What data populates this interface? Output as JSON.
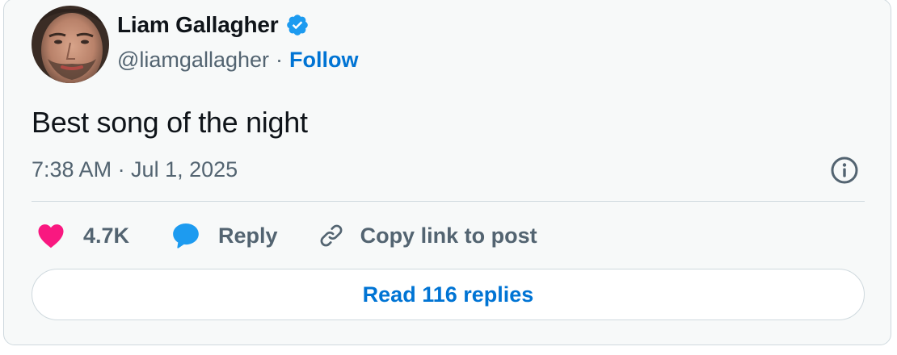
{
  "author": {
    "name": "Liam Gallagher",
    "handle": "@liamgallagher",
    "separator": "·",
    "follow_label": "Follow",
    "verified": true,
    "avatar_icon": "avatar-photo"
  },
  "post": {
    "text": "Best song of the night",
    "timestamp": "7:38 AM · Jul 1, 2025"
  },
  "actions": {
    "like_count": "4.7K",
    "reply_label": "Reply",
    "copy_label": "Copy link to post"
  },
  "footer": {
    "read_replies_label": "Read 116 replies"
  },
  "colors": {
    "link_blue": "#0074d4",
    "like_pink": "#f91880",
    "reply_blue": "#1d9bf0",
    "muted_text": "#536471",
    "card_bg": "#f7f9f9",
    "border": "#cfd9de"
  }
}
